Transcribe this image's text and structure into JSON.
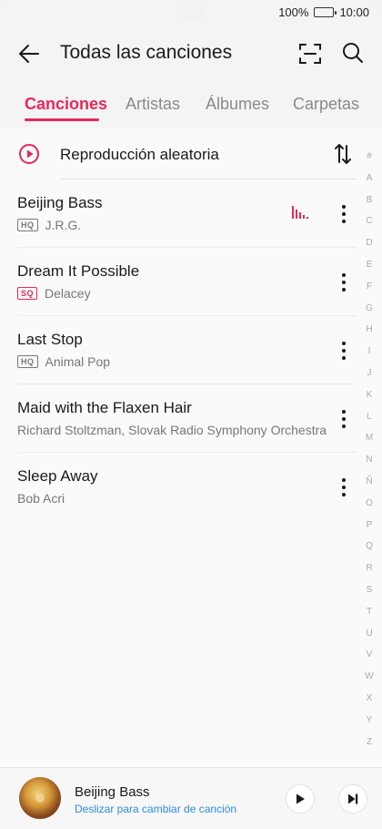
{
  "status_bar": {
    "battery_percent": "100%",
    "time": "10:00",
    "battery_icon": "battery-full-icon"
  },
  "header": {
    "title": "Todas las canciones",
    "back_icon": "arrow-left-icon",
    "scan_icon": "scan-icon",
    "search_icon": "search-icon"
  },
  "tabs": [
    {
      "label": "Canciones",
      "active": true
    },
    {
      "label": "Artistas",
      "active": false
    },
    {
      "label": "Álbumes",
      "active": false
    },
    {
      "label": "Carpetas",
      "active": false
    }
  ],
  "shuffle": {
    "label": "Reproducción aleatoria",
    "icon": "play-circle-icon",
    "sort_icon": "sort-icon"
  },
  "songs": [
    {
      "title": "Beijing Bass",
      "badge": "HQ",
      "artist": "J.R.G.",
      "playing": true
    },
    {
      "title": "Dream It Possible",
      "badge": "SQ",
      "artist": "Delacey",
      "playing": false
    },
    {
      "title": "Last Stop",
      "badge": "HQ",
      "artist": "Animal Pop",
      "playing": false
    },
    {
      "title": "Maid with the Flaxen Hair",
      "badge": "",
      "artist": "Richard Stoltzman, Slovak Radio Symphony Orchestra",
      "playing": false
    },
    {
      "title": "Sleep Away",
      "badge": "",
      "artist": "Bob Acri",
      "playing": false
    }
  ],
  "alphabet_index": [
    "#",
    "A",
    "B",
    "C",
    "D",
    "E",
    "F",
    "G",
    "H",
    "I",
    "J",
    "K",
    "L",
    "M",
    "N",
    "Ñ",
    "O",
    "P",
    "Q",
    "R",
    "S",
    "T",
    "U",
    "V",
    "W",
    "X",
    "Y",
    "Z"
  ],
  "now_playing": {
    "title": "Beijing Bass",
    "hint": "Deslizar para cambiar de canción",
    "play_icon": "play-icon",
    "next_icon": "skip-next-icon"
  },
  "colors": {
    "accent": "#e8285a",
    "hint_blue": "#2d8be0"
  }
}
